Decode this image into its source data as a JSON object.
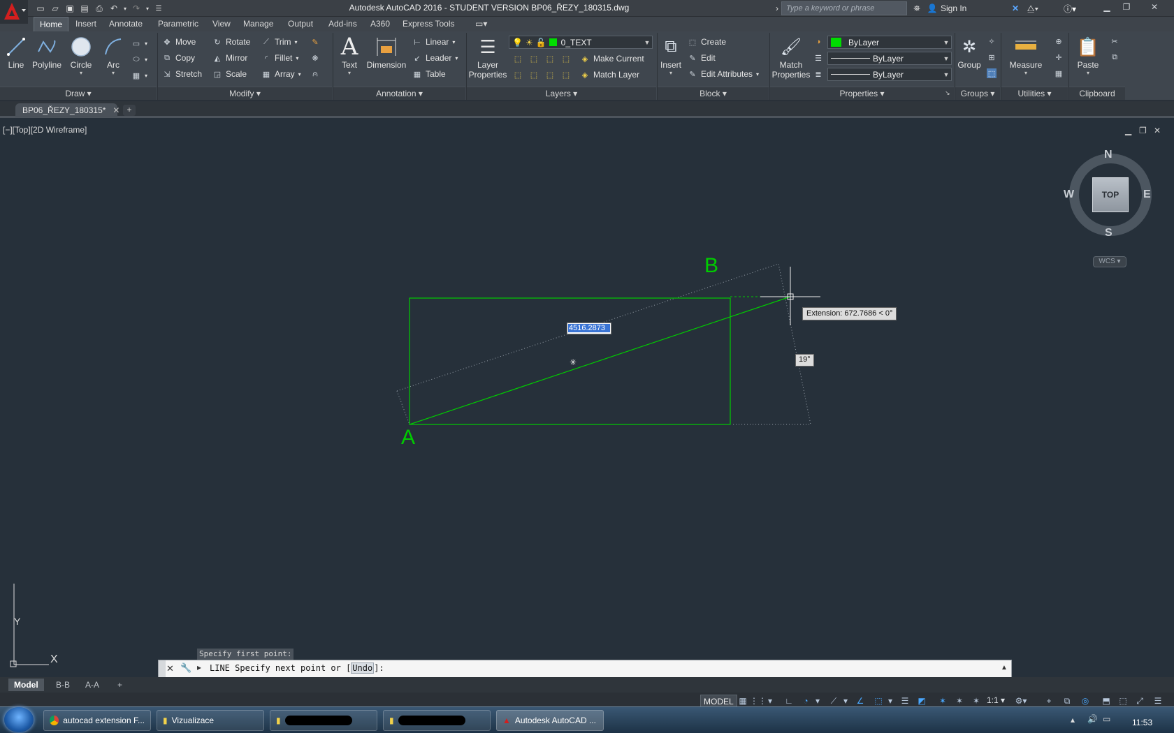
{
  "window": {
    "title": "Autodesk AutoCAD 2016 - STUDENT VERSION    BP06_ŘEZY_180315.dwg",
    "search_placeholder": "Type a keyword or phrase",
    "sign_in": "Sign In"
  },
  "ribbon_tabs": [
    "Home",
    "Insert",
    "Annotate",
    "Parametric",
    "View",
    "Manage",
    "Output",
    "Add-ins",
    "A360",
    "Express Tools"
  ],
  "draw": {
    "label": "Draw",
    "line": "Line",
    "polyline": "Polyline",
    "circle": "Circle",
    "arc": "Arc"
  },
  "modify": {
    "label": "Modify",
    "move": "Move",
    "rotate": "Rotate",
    "trim": "Trim",
    "copy": "Copy",
    "mirror": "Mirror",
    "fillet": "Fillet",
    "stretch": "Stretch",
    "scale": "Scale",
    "array": "Array"
  },
  "annotation": {
    "label": "Annotation",
    "text": "Text",
    "dimension": "Dimension",
    "linear": "Linear",
    "leader": "Leader",
    "table": "Table"
  },
  "layers": {
    "label": "Layers",
    "layer_properties": "Layer Properties",
    "current_layer": "0_TEXT",
    "make_current": "Make Current",
    "match_layer": "Match Layer"
  },
  "block": {
    "label": "Block",
    "insert": "Insert",
    "create": "Create",
    "edit": "Edit",
    "edit_attributes": "Edit Attributes"
  },
  "properties": {
    "label": "Properties",
    "match_properties": "Match Properties",
    "color": "ByLayer",
    "linetype": "ByLayer",
    "lineweight": "ByLayer"
  },
  "groups": {
    "label": "Groups",
    "group": "Group"
  },
  "utilities": {
    "label": "Utilities",
    "measure": "Measure"
  },
  "clipboard": {
    "label": "Clipboard",
    "paste": "Paste"
  },
  "document_tab": "BP06_ŘEZY_180315*",
  "viewport": {
    "label": "[−][Top][2D Wireframe]",
    "point_a": "A",
    "point_b": "B",
    "dynamic_input_value": "4516.2873",
    "extension_tooltip": "Extension: 672.7686 < 0°",
    "angle_tooltip": "19°",
    "ucs_x": "X",
    "ucs_y": "Y"
  },
  "viewcube": {
    "n": "N",
    "s": "S",
    "e": "E",
    "w": "W",
    "face": "TOP",
    "wcs": "WCS"
  },
  "command": {
    "history": "Specify first point:",
    "prompt_prefix": "LINE Specify next point or [",
    "option": "Undo",
    "prompt_suffix": "]:"
  },
  "layout_tabs": [
    "Model",
    "B-B",
    "A-A"
  ],
  "status": {
    "model": "MODEL",
    "scale": "1:1"
  },
  "taskbar": {
    "items": [
      "autocad extension F...",
      "Vizualizace",
      "",
      "",
      "Autodesk AutoCAD ..."
    ],
    "clock": "11:53"
  },
  "colors": {
    "drawing_green": "#00cc00",
    "viewport_bg": "#26303a",
    "accent_red": "#d21f1f"
  }
}
